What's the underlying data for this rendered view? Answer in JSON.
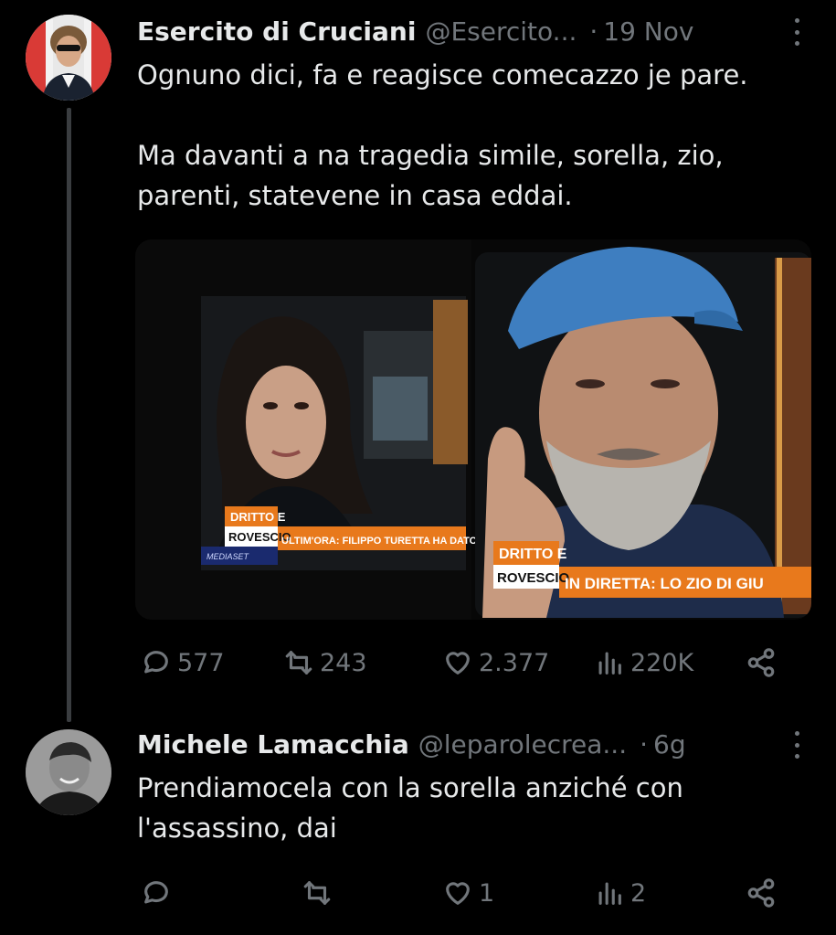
{
  "tweet1": {
    "name": "Esercito di Cruciani",
    "handle": "@Esercito...",
    "dot": "·",
    "time": "19 Nov",
    "text_line1": "Ognuno dici, fa e reagisce comecazzo je pare.",
    "text_line2": "Ma davanti a na tragedia simile, sorella, zio,",
    "text_line3": "parenti, statevene in casa eddai.",
    "media": {
      "left_banner_top": "DRITTO E",
      "left_banner_bottom": "ROVESCIO",
      "left_ticker": "ULTIM'ORA: FILIPPO TURETTA HA DATO IL CO",
      "left_network": "MEDIASET",
      "right_banner_top": "DRITTO E",
      "right_banner_bottom": "ROVESCIO",
      "right_ticker": "IN DIRETTA: LO ZIO DI GIU"
    },
    "actions": {
      "replies": "577",
      "reposts": "243",
      "likes": "2.377",
      "views": "220K"
    }
  },
  "tweet2": {
    "name": "Michele Lamacchia",
    "handle": "@leparolecrea...",
    "dot": "·",
    "time": "6g",
    "text_line1": "Prendiamocela con la sorella anziché con",
    "text_line2": "l'assassino, dai",
    "actions": {
      "replies": "",
      "reposts": "",
      "likes": "1",
      "views": "2"
    }
  },
  "colors": {
    "background": "#000000",
    "text": "#e7e9ea",
    "muted": "#71767b",
    "ticker_orange": "#e8791c"
  },
  "icons": [
    "reply-icon",
    "repost-icon",
    "like-icon",
    "views-icon",
    "share-icon",
    "more-icon"
  ]
}
